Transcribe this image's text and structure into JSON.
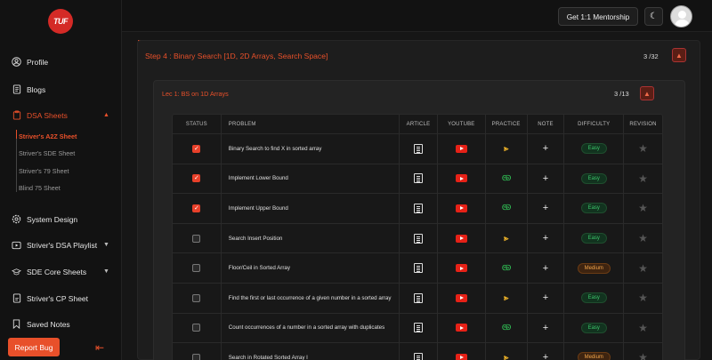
{
  "sidebar": {
    "logo_text": "TUF",
    "items": [
      {
        "label": "Profile",
        "icon": "user-circle-icon"
      },
      {
        "label": "Blogs",
        "icon": "document-icon"
      },
      {
        "label": "DSA Sheets",
        "icon": "clipboard-icon"
      },
      {
        "label": "System Design",
        "icon": "gear-icon"
      },
      {
        "label": "Striver's DSA Playlist",
        "icon": "play-icon"
      },
      {
        "label": "SDE Core Sheets",
        "icon": "graduation-cap-icon"
      },
      {
        "label": "Striver's CP Sheet",
        "icon": "document-icon"
      },
      {
        "label": "Saved Notes",
        "icon": "bookmark-icon"
      }
    ],
    "sub_items": [
      "Striver's A2Z Sheet",
      "Striver's SDE Sheet",
      "Striver's 79 Sheet",
      "Blind 75 Sheet"
    ],
    "report_bug": "Report Bug"
  },
  "topbar": {
    "mentorship": "Get 1:1 Mentorship"
  },
  "step": {
    "title": "Step 4 : Binary Search [1D, 2D Arrays, Search Space]",
    "count": "3 /32"
  },
  "lecture": {
    "title": "Lec 1: BS on 1D Arrays",
    "count": "3 /13"
  },
  "table": {
    "headers": [
      "STATUS",
      "PROBLEM",
      "ARTICLE",
      "YOUTUBE",
      "PRACTICE",
      "NOTE",
      "DIFFICULTY",
      "REVISION"
    ],
    "rows": [
      {
        "problem": "Binary Search to find X in sorted array",
        "done": true,
        "practice": "codingninjas",
        "difficulty": "Easy"
      },
      {
        "problem": "Implement Lower Bound",
        "done": true,
        "practice": "gfg",
        "difficulty": "Easy"
      },
      {
        "problem": "Implement Upper Bound",
        "done": true,
        "practice": "gfg",
        "difficulty": "Easy"
      },
      {
        "problem": "Search Insert Position",
        "done": false,
        "practice": "codingninjas",
        "difficulty": "Easy"
      },
      {
        "problem": "Floor/Ceil in Sorted Array",
        "done": false,
        "practice": "gfg",
        "difficulty": "Medium"
      },
      {
        "problem": "Find the first or last occurrence of a given number in a sorted array",
        "done": false,
        "practice": "codingninjas",
        "difficulty": "Easy"
      },
      {
        "problem": "Count occurrences of a number in a sorted array with duplicates",
        "done": false,
        "practice": "gfg",
        "difficulty": "Easy"
      },
      {
        "problem": "Search in Rotated Sorted Array I",
        "done": false,
        "practice": "codingninjas",
        "difficulty": "Medium"
      }
    ]
  },
  "colors": {
    "accent": "#e8502a",
    "easy": "#3cc46a",
    "medium": "#f0a44a"
  }
}
